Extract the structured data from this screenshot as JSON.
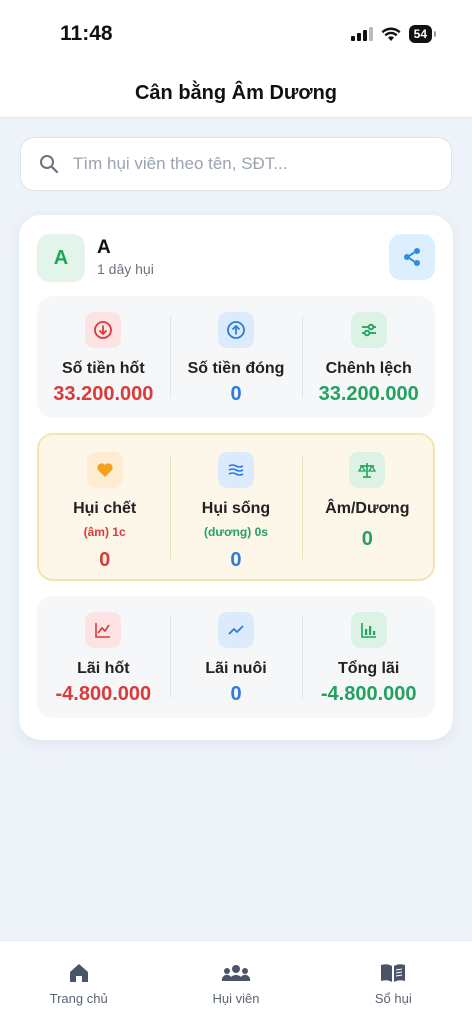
{
  "status": {
    "time": "11:48",
    "battery": "54"
  },
  "header": {
    "title": "Cân bằng Âm Dương"
  },
  "search": {
    "placeholder": "Tìm hụi viên theo tên, SĐT..."
  },
  "member": {
    "initial": "A",
    "name": "A",
    "subtitle": "1 dây hụi",
    "share_icon": "share-icon"
  },
  "row1": [
    {
      "label": "Số tiền hốt",
      "value": "33.200.000",
      "icon": "arrow-down-circle-icon",
      "color": "#d93a3a"
    },
    {
      "label": "Số tiền đóng",
      "value": "0",
      "icon": "arrow-up-circle-icon",
      "color": "#2f7bd8"
    },
    {
      "label": "Chênh lệch",
      "value": "33.200.000",
      "icon": "sliders-icon",
      "color": "#23a15d"
    }
  ],
  "row2": [
    {
      "label": "Hụi chết",
      "sub": "(âm) 1c",
      "value": "0",
      "icon": "heart-icon",
      "color": "#d93a3a"
    },
    {
      "label": "Hụi sống",
      "sub": "(dương) 0s",
      "value": "0",
      "icon": "waves-icon",
      "color": "#2f7bd8"
    },
    {
      "label": "Âm/Dương",
      "value": "0",
      "icon": "scale-icon",
      "color": "#23a15d"
    }
  ],
  "row3": [
    {
      "label": "Lãi hốt",
      "value": "-4.800.000",
      "icon": "line-chart-icon",
      "color": "#d93a3a"
    },
    {
      "label": "Lãi nuôi",
      "value": "0",
      "icon": "trending-up-icon",
      "color": "#2f7bd8"
    },
    {
      "label": "Tổng lãi",
      "value": "-4.800.000",
      "icon": "bar-chart-icon",
      "color": "#23a15d"
    }
  ],
  "tabs": [
    {
      "label": "Trang chủ",
      "icon": "home-icon"
    },
    {
      "label": "Hụi viên",
      "icon": "users-icon"
    },
    {
      "label": "Sổ hụi",
      "icon": "book-icon"
    }
  ]
}
